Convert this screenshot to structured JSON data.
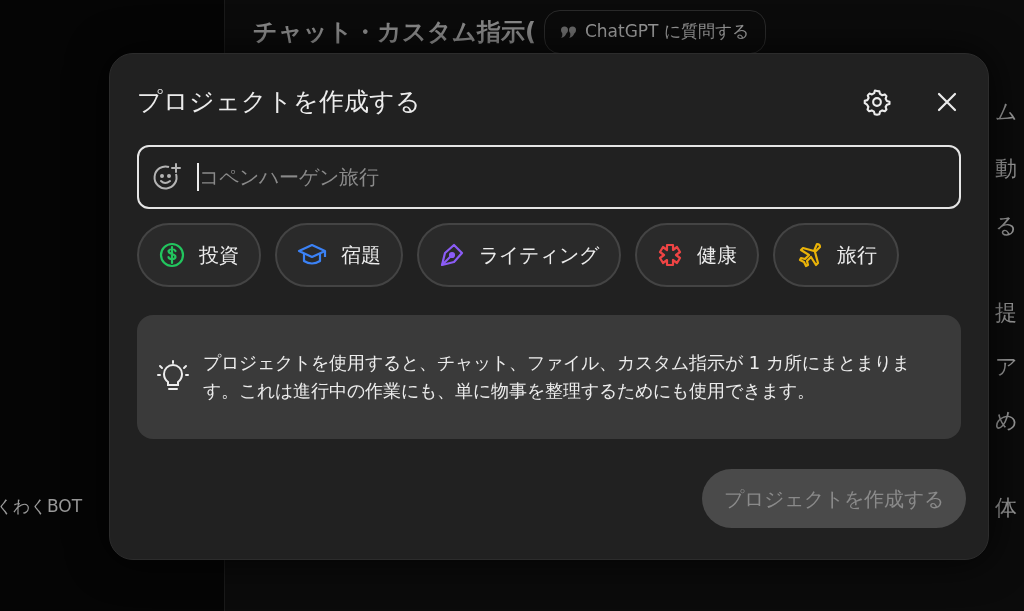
{
  "background": {
    "heading": "チャット・カスタム指示(",
    "ask_button": "ChatGPT に質問する",
    "sidebar_text": "くわくBOT",
    "right_fragments": [
      "ム",
      "動",
      "る",
      "提",
      "ア",
      "め",
      "体"
    ]
  },
  "dialog": {
    "title": "プロジェクトを作成する",
    "name_field": {
      "placeholder": "コペンハーゲン旅行"
    },
    "chips": [
      {
        "kind": "dollar",
        "label": "投資",
        "color": "#22c55e"
      },
      {
        "kind": "cap",
        "label": "宿題",
        "color": "#3b82f6"
      },
      {
        "kind": "pen",
        "label": "ライティング",
        "color": "#8b5cf6"
      },
      {
        "kind": "health",
        "label": "健康",
        "color": "#ef4444"
      },
      {
        "kind": "plane",
        "label": "旅行",
        "color": "#eab308"
      }
    ],
    "info": "プロジェクトを使用すると、チャット、ファイル、カスタム指示が 1 カ所にまとまります。これは進行中の作業にも、単に物事を整理するためにも使用できます。",
    "create_button": {
      "label": "プロジェクトを作成する",
      "disabled": true
    }
  }
}
